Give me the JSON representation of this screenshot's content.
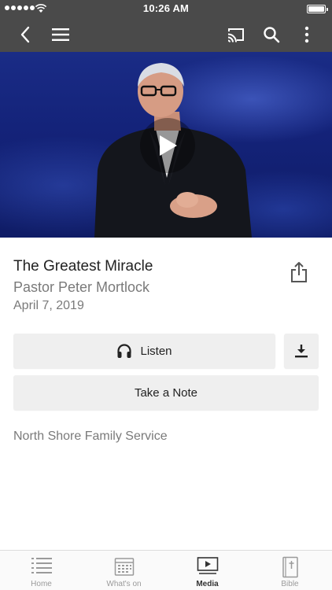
{
  "status_bar": {
    "time": "10:26 AM"
  },
  "nav": {
    "back_icon": "chevron-left-icon",
    "menu_icon": "hamburger-menu-icon",
    "cast_icon": "cast-icon",
    "search_icon": "search-icon",
    "more_icon": "more-vertical-icon"
  },
  "video": {
    "play_icon": "play-icon"
  },
  "sermon": {
    "title": "The Greatest Miracle",
    "speaker": "Pastor Peter Mortlock",
    "date": "April 7, 2019",
    "description": "North Shore Family Service"
  },
  "actions": {
    "listen_label": "Listen",
    "take_note_label": "Take a Note",
    "share_icon": "share-icon",
    "download_icon": "download-icon",
    "headphones_icon": "headphones-icon"
  },
  "tab_bar": {
    "tabs": [
      {
        "label": "Home",
        "icon": "list-icon",
        "active": false
      },
      {
        "label": "What's on",
        "icon": "calendar-icon",
        "active": false
      },
      {
        "label": "Media",
        "icon": "media-player-icon",
        "active": true
      },
      {
        "label": "Bible",
        "icon": "bible-icon",
        "active": false
      }
    ]
  },
  "colors": {
    "header_bg": "#4a4a4a",
    "hero_blue": "#14237a",
    "button_bg": "#efefef",
    "secondary_text": "#7a7a7a"
  }
}
